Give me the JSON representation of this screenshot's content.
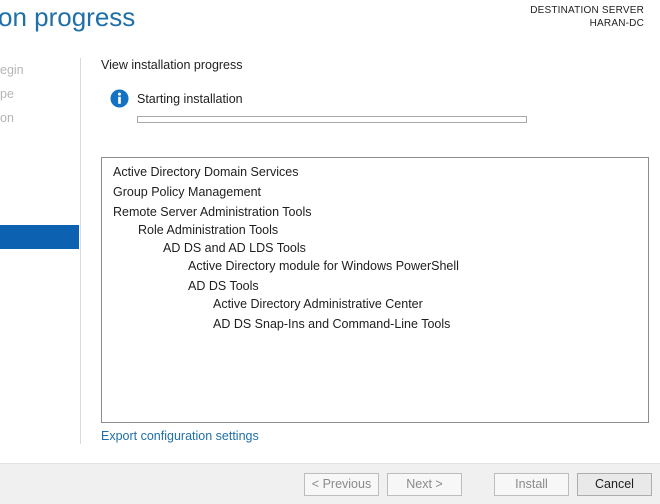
{
  "header": {
    "title": "on progress",
    "destination_label": "DESTINATION SERVER",
    "destination_server": "HARAN-DC"
  },
  "sidebar": {
    "items": [
      {
        "label": "egin"
      },
      {
        "label": "pe"
      },
      {
        "label": "on"
      }
    ]
  },
  "main": {
    "section_title": "View installation progress",
    "status_text": "Starting installation",
    "progress": 0,
    "features": [
      {
        "label": "Active Directory Domain Services",
        "level": 0
      },
      {
        "label": "Group Policy Management",
        "level": 0
      },
      {
        "label": "Remote Server Administration Tools",
        "level": 0
      },
      {
        "label": "Role Administration Tools",
        "level": 1
      },
      {
        "label": "AD DS and AD LDS Tools",
        "level": 2
      },
      {
        "label": "Active Directory module for Windows PowerShell",
        "level": 3
      },
      {
        "label": "AD DS Tools",
        "level": 3
      },
      {
        "label": "Active Directory Administrative Center",
        "level": 4
      },
      {
        "label": "AD DS Snap-Ins and Command-Line Tools",
        "level": 4
      }
    ],
    "export_link": "Export configuration settings"
  },
  "footer": {
    "previous": "< Previous",
    "next": "Next >",
    "install": "Install",
    "cancel": "Cancel"
  },
  "colors": {
    "accent": "#1f6fa8",
    "selection": "#0c62b0",
    "info_icon": "#1572c3"
  }
}
